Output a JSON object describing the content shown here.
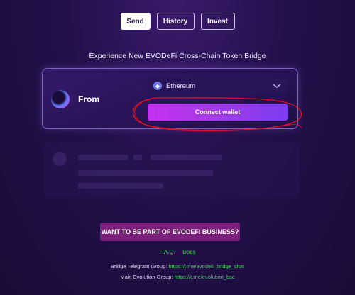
{
  "tabs": [
    {
      "label": "Send",
      "active": true
    },
    {
      "label": "History",
      "active": false
    },
    {
      "label": "Invest",
      "active": false
    }
  ],
  "headline": "Experience New EVODeFi Cross-Chain Token Bridge",
  "card": {
    "from_label": "From",
    "network_select": {
      "value": "Ethereum",
      "icon": "ethereum-icon"
    },
    "connect_label": "Connect wallet"
  },
  "cta_label": "WANT TO BE PART OF EVODEFI BUSINESS?",
  "footer": {
    "links": [
      "F.A.Q.",
      "Docs"
    ],
    "telegram_label": "Bridge Telegram Group: ",
    "telegram_url": "https://t.me/evodefi_bridge_chat",
    "main_label": "Main Evolution Group: ",
    "main_url": "https://t.me/evolution_bsc"
  },
  "colors": {
    "accent": "#a53be8",
    "link": "#39d353",
    "cta": "#7a1f7a",
    "annotation": "#e01020"
  }
}
